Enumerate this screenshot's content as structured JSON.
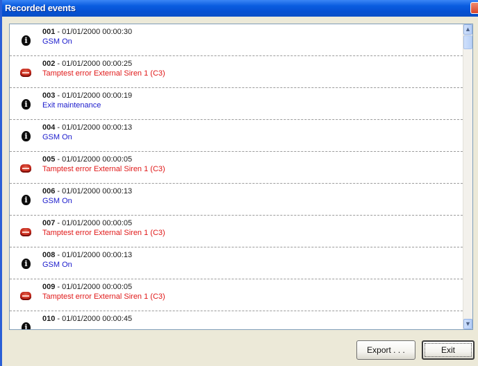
{
  "window": {
    "title": "Recorded events"
  },
  "events": [
    {
      "num": "001",
      "timestamp": "01/01/2000 00:00:30",
      "message": "GSM On",
      "kind": "info"
    },
    {
      "num": "002",
      "timestamp": "01/01/2000 00:00:25",
      "message": "Tamptest error External Siren 1 (C3)",
      "kind": "error"
    },
    {
      "num": "003",
      "timestamp": "01/01/2000 00:00:19",
      "message": "Exit maintenance",
      "kind": "info"
    },
    {
      "num": "004",
      "timestamp": "01/01/2000 00:00:13",
      "message": "GSM On",
      "kind": "info"
    },
    {
      "num": "005",
      "timestamp": "01/01/2000 00:00:05",
      "message": "Tamptest error External Siren 1 (C3)",
      "kind": "error"
    },
    {
      "num": "006",
      "timestamp": "01/01/2000 00:00:13",
      "message": "GSM On",
      "kind": "info"
    },
    {
      "num": "007",
      "timestamp": "01/01/2000 00:00:05",
      "message": "Tamptest error External Siren 1 (C3)",
      "kind": "error"
    },
    {
      "num": "008",
      "timestamp": "01/01/2000 00:00:13",
      "message": "GSM On",
      "kind": "info"
    },
    {
      "num": "009",
      "timestamp": "01/01/2000 00:00:05",
      "message": "Tamptest error External Siren 1 (C3)",
      "kind": "error"
    },
    {
      "num": "010",
      "timestamp": "01/01/2000 00:00:45",
      "message": "",
      "kind": "info"
    }
  ],
  "icons": {
    "info": "info-icon",
    "error": "error-icon"
  },
  "colors": {
    "info_text": "#1a1acc",
    "error_text": "#e01818",
    "titlebar": "#0a5de0"
  },
  "separator": " - ",
  "buttons": {
    "export_label": "Export . . .",
    "exit_label": "Exit"
  }
}
